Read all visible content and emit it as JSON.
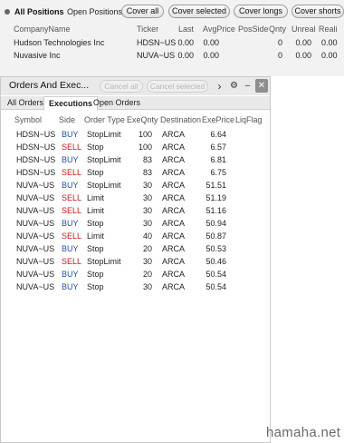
{
  "positions": {
    "tabs": [
      "All Positions",
      "Open Positions"
    ],
    "buttons": [
      "Cover all",
      "Cover selected",
      "Cover longs",
      "Cover shorts"
    ],
    "columns": [
      "CompanyName",
      "Ticker",
      "Last",
      "AvgPrice",
      "PosSide",
      "Qnty",
      "Unreal",
      "Reali"
    ],
    "rows": [
      {
        "company": "Hudson Technologies Inc",
        "ticker": "HDSN~US",
        "last": "0.00",
        "avg": "0.00",
        "side": "",
        "qnty": "0",
        "unreal": "0.00",
        "real": "0.00"
      },
      {
        "company": "Nuvasive Inc",
        "ticker": "NUVA~US",
        "last": "0.00",
        "avg": "0.00",
        "side": "",
        "qnty": "0",
        "unreal": "0.00",
        "real": "0.00"
      }
    ]
  },
  "orders_window": {
    "title": "Orders And Exec...",
    "cancel_all": "Cancel all",
    "cancel_selected": "Cancel selected",
    "arrow": "›",
    "gear": "⚙",
    "minimize": "–",
    "close": "✕",
    "tabs": [
      "All Orders",
      "Executions",
      "Open Orders"
    ],
    "active_tab": "Executions",
    "columns": [
      "Symbol",
      "Side",
      "Order Type",
      "ExeQnty",
      "Destination",
      "ExePrice",
      "LiqFlag"
    ],
    "rows": [
      {
        "symbol": "HDSN~US",
        "side": "BUY",
        "type": "StopLimit",
        "qty": "100",
        "dest": "ARCA",
        "price": "6.64"
      },
      {
        "symbol": "HDSN~US",
        "side": "SELL",
        "type": "Stop",
        "qty": "100",
        "dest": "ARCA",
        "price": "6.57"
      },
      {
        "symbol": "HDSN~US",
        "side": "BUY",
        "type": "StopLimit",
        "qty": "83",
        "dest": "ARCA",
        "price": "6.81"
      },
      {
        "symbol": "HDSN~US",
        "side": "SELL",
        "type": "Stop",
        "qty": "83",
        "dest": "ARCA",
        "price": "6.75"
      },
      {
        "symbol": "NUVA~US",
        "side": "BUY",
        "type": "StopLimit",
        "qty": "30",
        "dest": "ARCA",
        "price": "51.51"
      },
      {
        "symbol": "NUVA~US",
        "side": "SELL",
        "type": "Limit",
        "qty": "30",
        "dest": "ARCA",
        "price": "51.19"
      },
      {
        "symbol": "NUVA~US",
        "side": "SELL",
        "type": "Limit",
        "qty": "30",
        "dest": "ARCA",
        "price": "51.16"
      },
      {
        "symbol": "NUVA~US",
        "side": "BUY",
        "type": "Stop",
        "qty": "30",
        "dest": "ARCA",
        "price": "50.94"
      },
      {
        "symbol": "NUVA~US",
        "side": "SELL",
        "type": "Limit",
        "qty": "40",
        "dest": "ARCA",
        "price": "50.87"
      },
      {
        "symbol": "NUVA~US",
        "side": "BUY",
        "type": "Stop",
        "qty": "20",
        "dest": "ARCA",
        "price": "50.53"
      },
      {
        "symbol": "NUVA~US",
        "side": "SELL",
        "type": "StopLimit",
        "qty": "30",
        "dest": "ARCA",
        "price": "50.46"
      },
      {
        "symbol": "NUVA~US",
        "side": "BUY",
        "type": "Stop",
        "qty": "20",
        "dest": "ARCA",
        "price": "50.54"
      },
      {
        "symbol": "NUVA~US",
        "side": "BUY",
        "type": "Stop",
        "qty": "30",
        "dest": "ARCA",
        "price": "50.54"
      }
    ]
  },
  "watermark": "hamaha.net",
  "colors": {
    "buy": "#1f4fae",
    "sell": "#c4161c",
    "panel_bg": "#f2f2f2"
  }
}
